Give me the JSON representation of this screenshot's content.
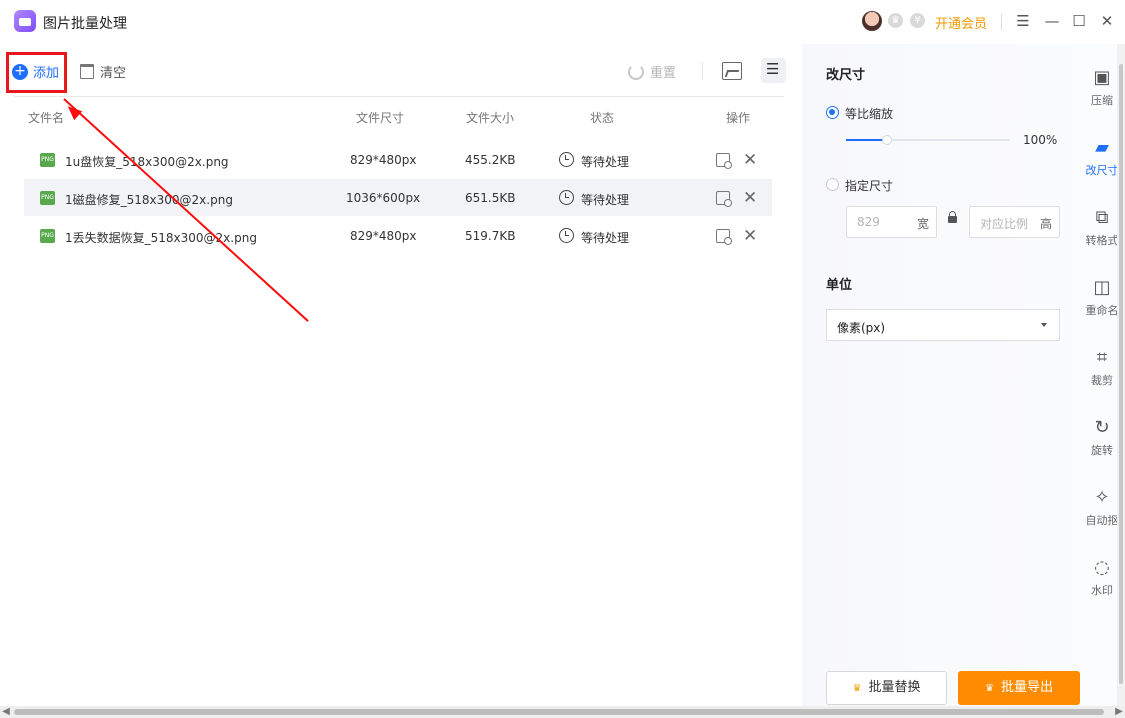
{
  "app": {
    "title": "图片批量处理",
    "vip_label": "开通会员",
    "window_controls": [
      "☰",
      "—",
      "☐",
      "✕"
    ]
  },
  "toolbar": {
    "add_label": "添加",
    "clear_label": "清空",
    "reset_label": "重置",
    "view_modes": [
      "image-view",
      "list-view"
    ]
  },
  "table": {
    "headers": [
      "文件名",
      "文件尺寸",
      "文件大小",
      "状态",
      "操作"
    ],
    "rows": [
      {
        "name": "1u盘恢复_518x300@2x.png",
        "dimensions": "829*480px",
        "size": "455.2KB",
        "status": "等待处理"
      },
      {
        "name": "1磁盘修复_518x300@2x.png",
        "dimensions": "1036*600px",
        "size": "651.5KB",
        "status": "等待处理"
      },
      {
        "name": "1丢失数据恢复_518x300@2x.png",
        "dimensions": "829*480px",
        "size": "519.7KB",
        "status": "等待处理"
      }
    ]
  },
  "resize_panel": {
    "title": "改尺寸",
    "scale_label": "等比缩放",
    "scale_value": "100%",
    "custom_label": "指定尺寸",
    "width_value": "829",
    "width_unit": "宽",
    "height_value": "对应比例",
    "height_unit": "高",
    "unit_title": "单位",
    "unit_selected": "像素(px)"
  },
  "side_tabs": [
    {
      "label": "压缩",
      "icon": "compress-icon"
    },
    {
      "label": "改尺寸",
      "icon": "resize-icon"
    },
    {
      "label": "转格式",
      "icon": "convert-icon"
    },
    {
      "label": "重命名",
      "icon": "rename-icon"
    },
    {
      "label": "裁剪",
      "icon": "crop-icon"
    },
    {
      "label": "旋转",
      "icon": "rotate-icon"
    },
    {
      "label": "自动抠",
      "icon": "cutout-icon"
    },
    {
      "label": "水印",
      "icon": "watermark-icon"
    }
  ],
  "actions": {
    "batch_replace": "批量替换",
    "batch_export": "批量导出"
  },
  "colors": {
    "accent": "#1e6fff",
    "orange": "#ff8c00",
    "highlight": "#e8171c"
  }
}
